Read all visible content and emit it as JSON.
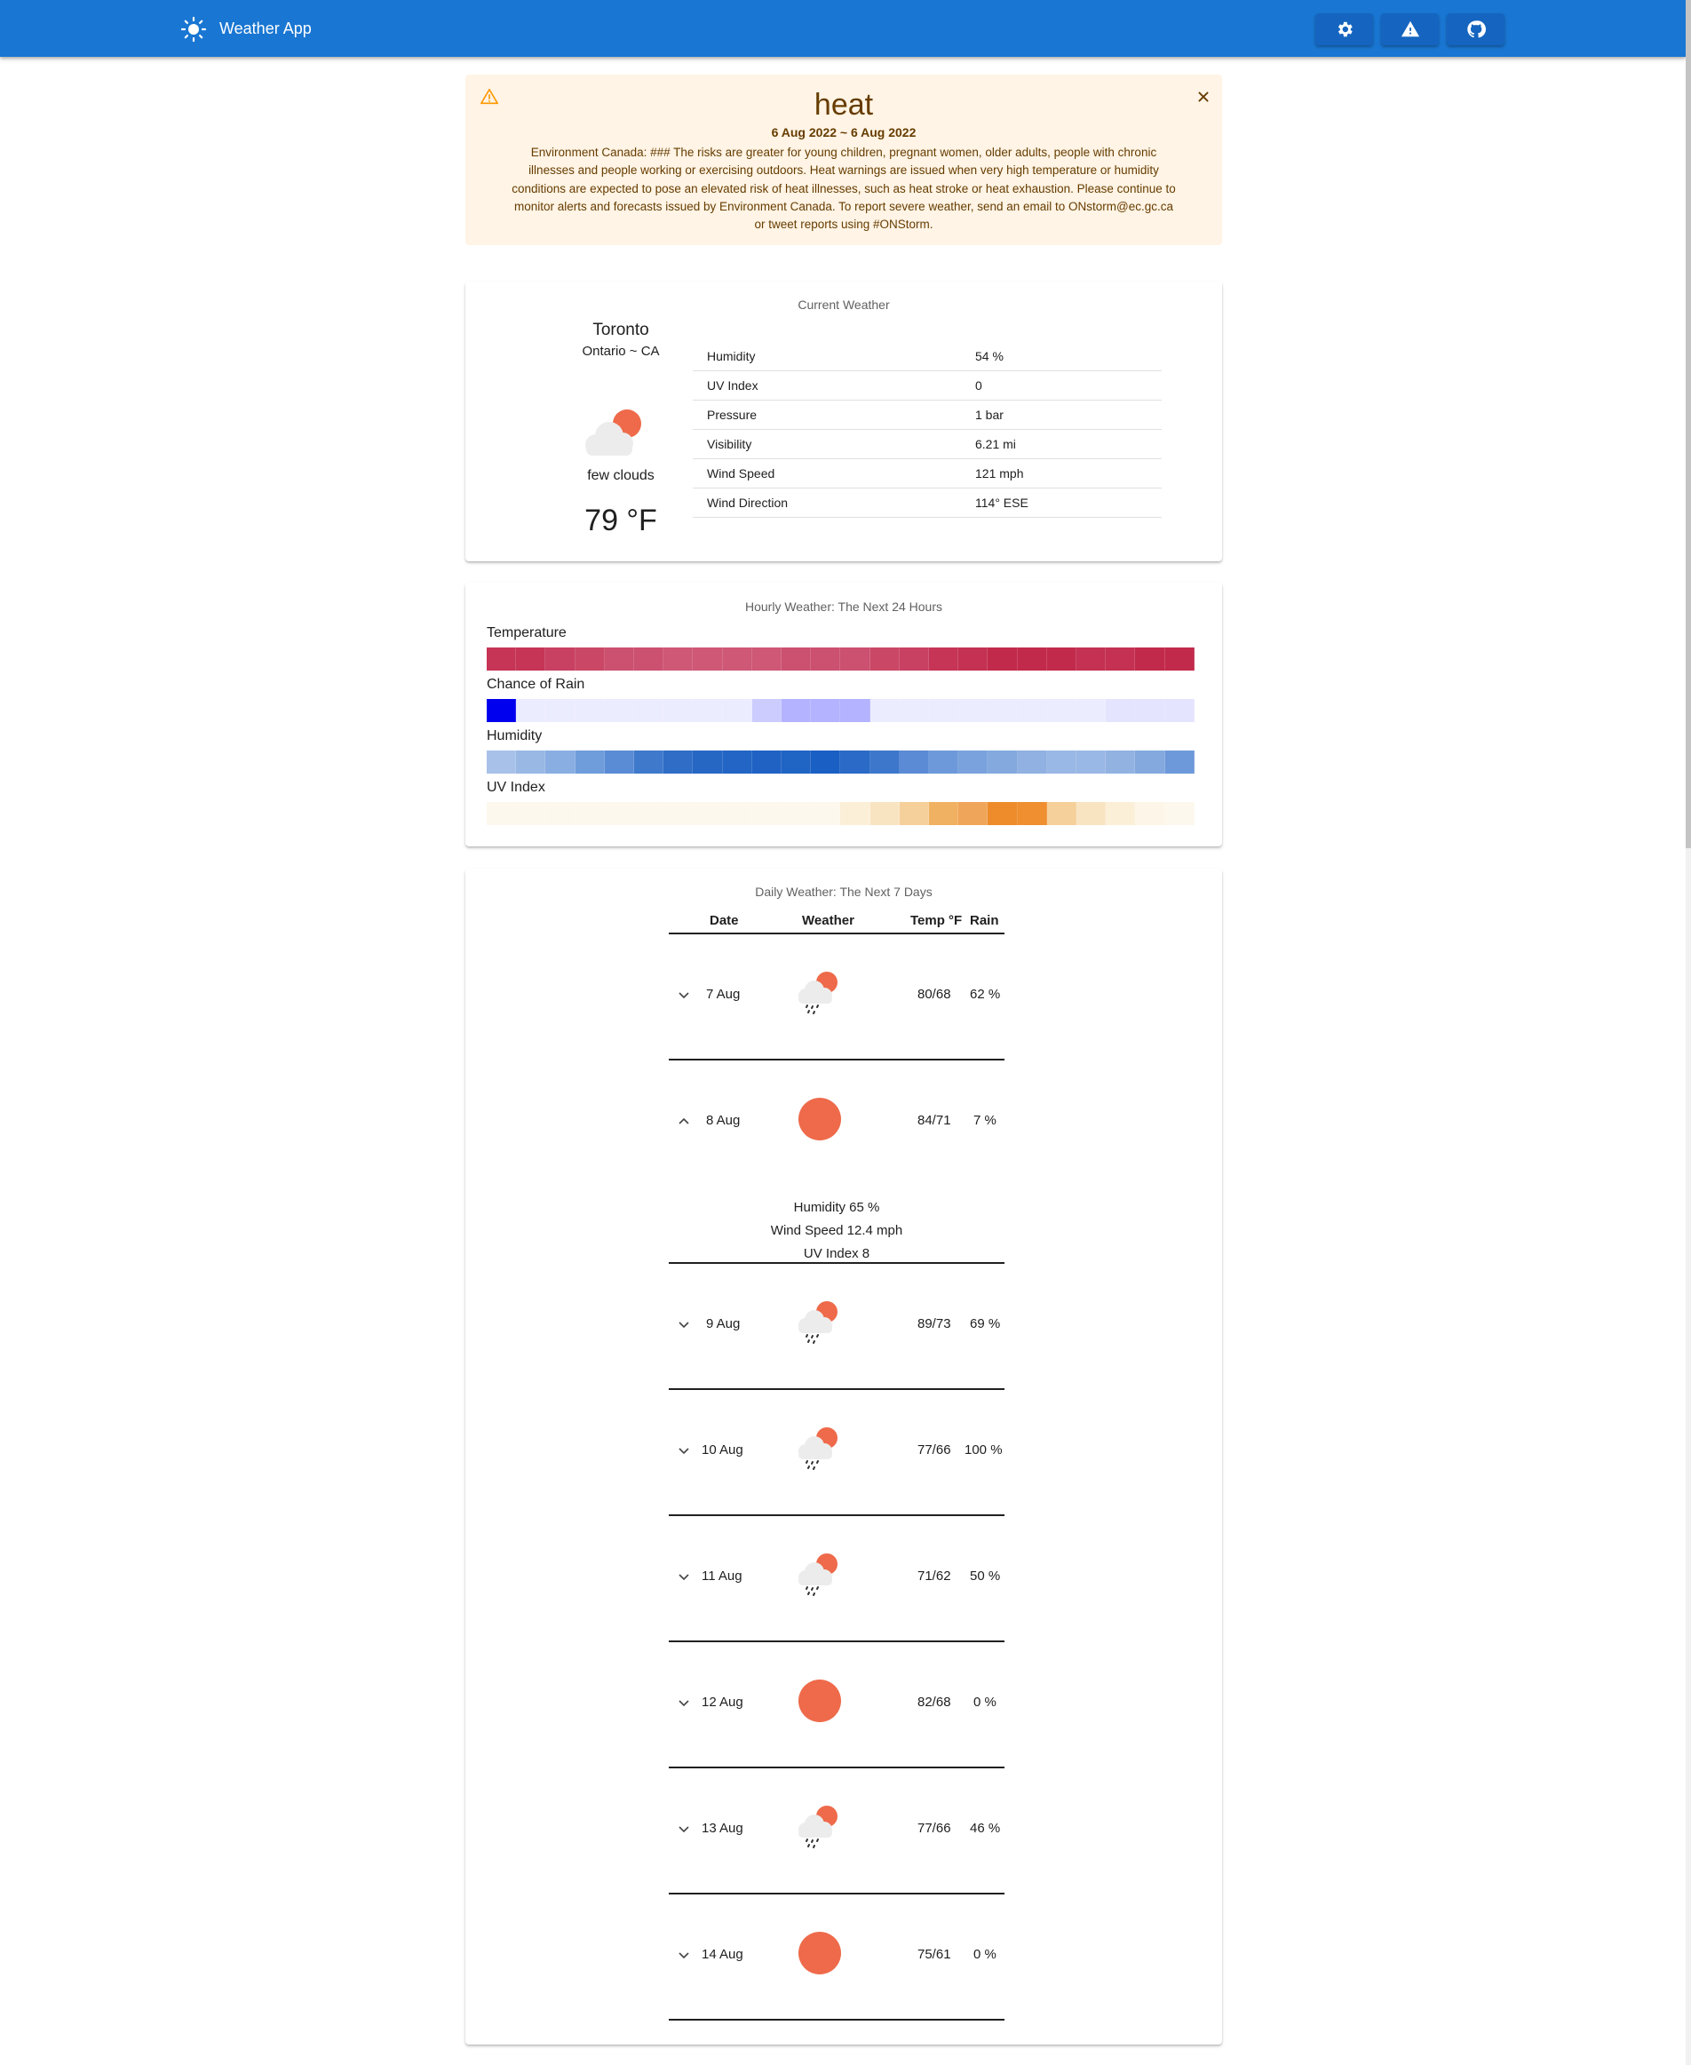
{
  "app": {
    "title": "Weather App"
  },
  "toolbar": {
    "settings_icon": "gear-icon",
    "alerts_icon": "warning-icon",
    "github_icon": "github-icon"
  },
  "alert": {
    "title": "heat",
    "dates": "6 Aug 2022 ~ 6 Aug 2022",
    "body": "Environment Canada: ### The risks are greater for young children, pregnant women, older adults, people with chronic illnesses and people working or exercising outdoors. Heat warnings are issued when very high temperature or humidity conditions are expected to pose an elevated risk of heat illnesses, such as heat stroke or heat exhaustion. Please continue to monitor alerts and forecasts issued by Environment Canada. To report severe weather, send an email to ONstorm@ec.gc.ca or tweet reports using #ONStorm.",
    "colors": {
      "background": "#fff4e5",
      "text": "#663c00",
      "icon": "#ff9800"
    }
  },
  "current": {
    "title": "Current Weather",
    "city": "Toronto",
    "region": "Ontario ~ CA",
    "icon": "few-clouds-icon",
    "description": "few clouds",
    "temperature": "79 °F",
    "stats": [
      {
        "label": "Humidity",
        "value": "54 %"
      },
      {
        "label": "UV Index",
        "value": "0"
      },
      {
        "label": "Pressure",
        "value": "1 bar"
      },
      {
        "label": "Visibility",
        "value": "6.21 mi"
      },
      {
        "label": "Wind Speed",
        "value": "121 mph"
      },
      {
        "label": "Wind Direction",
        "value": "114° ESE"
      }
    ]
  },
  "hourly": {
    "title": "Hourly Weather: The Next 24 Hours",
    "temperature_label": "Temperature",
    "rain_label": "Chance of Rain",
    "humidity_label": "Humidity",
    "uv_label": "UV Index",
    "temperature_colors": [
      "#c63556",
      "#c63556",
      "#c84062",
      "#ca4866",
      "#cc5070",
      "#cc5070",
      "#ce5876",
      "#ce5876",
      "#ce5876",
      "#ce5876",
      "#cc5070",
      "#cc5070",
      "#cc5070",
      "#ca4866",
      "#c84062",
      "#c63556",
      "#c43152",
      "#c22a4c",
      "#c22a4c",
      "#c22a4c",
      "#c43152",
      "#c43152",
      "#c22a4c",
      "#c22a4c"
    ],
    "rain_colors": [
      "#0000ee",
      "#ececff",
      "#ececff",
      "#ececff",
      "#ececff",
      "#ececff",
      "#ececff",
      "#ececff",
      "#ececff",
      "#ccccff",
      "#b3b3ff",
      "#b3b3ff",
      "#b3b3ff",
      "#ececff",
      "#ececff",
      "#ececff",
      "#ececff",
      "#ececff",
      "#ececff",
      "#ececff",
      "#ececff",
      "#e4e4ff",
      "#e4e4ff",
      "#e4e4ff"
    ],
    "humidity_colors": [
      "#a8c1e8",
      "#99b8e4",
      "#89aee2",
      "#6f9cdb",
      "#5a8cd5",
      "#3f79cb",
      "#2f6dc6",
      "#2667c4",
      "#2265c5",
      "#1f62c4",
      "#2064c4",
      "#1a5fc4",
      "#2b6ac6",
      "#3d77cb",
      "#5a8bd4",
      "#6d99da",
      "#7aa2dc",
      "#84a9df",
      "#90b1e2",
      "#9ab8e5",
      "#9ab8e5",
      "#92b2e2",
      "#84a9df",
      "#6d99da"
    ],
    "uv_colors": [
      "#fdf8ed",
      "#fdf8ed",
      "#fdf8ed",
      "#fdf8ed",
      "#fdf8ed",
      "#fdf8ed",
      "#fdf8ed",
      "#fdf8ed",
      "#fdf8ed",
      "#fdf8ed",
      "#fdf8ed",
      "#fdf8ed",
      "#fbefd8",
      "#f9e4c2",
      "#f6d09a",
      "#f1b162",
      "#f0a65a",
      "#ee8c2b",
      "#ef8f30",
      "#f6d09a",
      "#f9e4c2",
      "#fbefd8",
      "#fdf6e8",
      "#fdf8ed"
    ]
  },
  "daily": {
    "title": "Daily Weather: The Next 7 Days",
    "headers": {
      "date": "Date",
      "weather": "Weather",
      "temp": "Temp °F",
      "rain": "Rain"
    },
    "rows": [
      {
        "date": "7 Aug",
        "icon": "rain-icon",
        "temp": "80/68",
        "rain": "62 %",
        "expanded": false
      },
      {
        "date": "8 Aug",
        "icon": "sun-icon",
        "temp": "84/71",
        "rain": "7 %",
        "expanded": true,
        "details": [
          "Humidity 65 %",
          "Wind Speed 12.4 mph",
          "UV Index 8"
        ]
      },
      {
        "date": "9 Aug",
        "icon": "rain-icon",
        "temp": "89/73",
        "rain": "69 %",
        "expanded": false
      },
      {
        "date": "10 Aug",
        "icon": "rain-icon",
        "temp": "77/66",
        "rain": "100 %",
        "expanded": false
      },
      {
        "date": "11 Aug",
        "icon": "rain-icon",
        "temp": "71/62",
        "rain": "50 %",
        "expanded": false
      },
      {
        "date": "12 Aug",
        "icon": "sun-icon",
        "temp": "82/68",
        "rain": "0 %",
        "expanded": false
      },
      {
        "date": "13 Aug",
        "icon": "rain-icon",
        "temp": "77/66",
        "rain": "46 %",
        "expanded": false
      },
      {
        "date": "14 Aug",
        "icon": "sun-icon",
        "temp": "75/61",
        "rain": "0 %",
        "expanded": false
      }
    ]
  },
  "colors": {
    "appbar": "#1976d2",
    "sun": "#ee6a4a",
    "cloud": "#ececec"
  }
}
